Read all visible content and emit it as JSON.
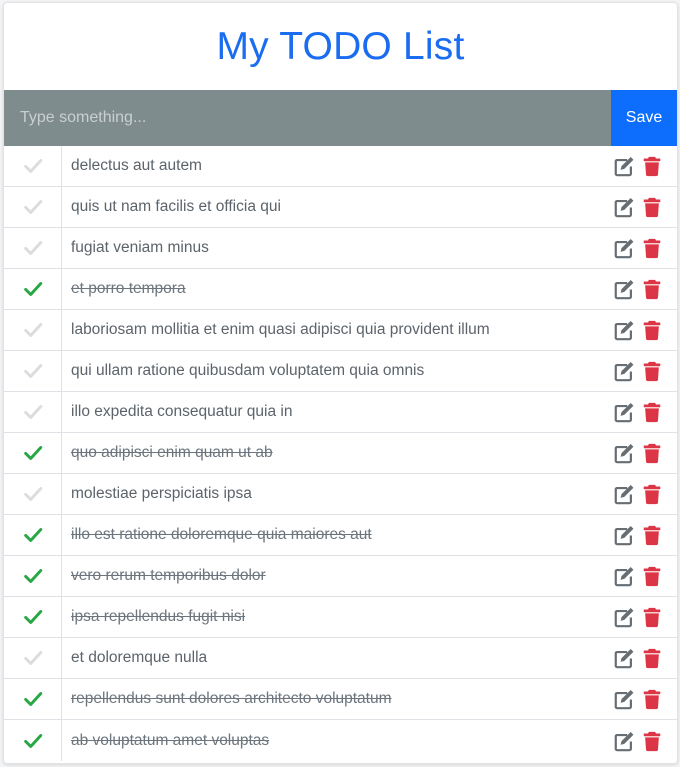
{
  "title": "My TODO List",
  "input": {
    "placeholder": "Type something...",
    "value": ""
  },
  "save_label": "Save",
  "colors": {
    "title": "#1a6cf0",
    "input_bg": "#7f8c8d",
    "save_bg": "#0d6efd",
    "check_done": "#28a745",
    "check_pending": "#dcdcdc",
    "text": "#5c636a",
    "done_text": "#6c757d",
    "edit_icon": "#666d73",
    "delete_icon": "#dc3545"
  },
  "icons": {
    "check": "check-icon",
    "edit": "edit-icon",
    "delete": "trash-icon"
  },
  "todos": [
    {
      "text": "delectus aut autem",
      "completed": false
    },
    {
      "text": "quis ut nam facilis et officia qui",
      "completed": false
    },
    {
      "text": "fugiat veniam minus",
      "completed": false
    },
    {
      "text": "et porro tempora",
      "completed": true
    },
    {
      "text": "laboriosam mollitia et enim quasi adipisci quia provident illum",
      "completed": false
    },
    {
      "text": "qui ullam ratione quibusdam voluptatem quia omnis",
      "completed": false
    },
    {
      "text": "illo expedita consequatur quia in",
      "completed": false
    },
    {
      "text": "quo adipisci enim quam ut ab",
      "completed": true
    },
    {
      "text": "molestiae perspiciatis ipsa",
      "completed": false
    },
    {
      "text": "illo est ratione doloremque quia maiores aut",
      "completed": true
    },
    {
      "text": "vero rerum temporibus dolor",
      "completed": true
    },
    {
      "text": "ipsa repellendus fugit nisi",
      "completed": true
    },
    {
      "text": "et doloremque nulla",
      "completed": false
    },
    {
      "text": "repellendus sunt dolores architecto voluptatum",
      "completed": true
    },
    {
      "text": "ab voluptatum amet voluptas",
      "completed": true
    }
  ]
}
